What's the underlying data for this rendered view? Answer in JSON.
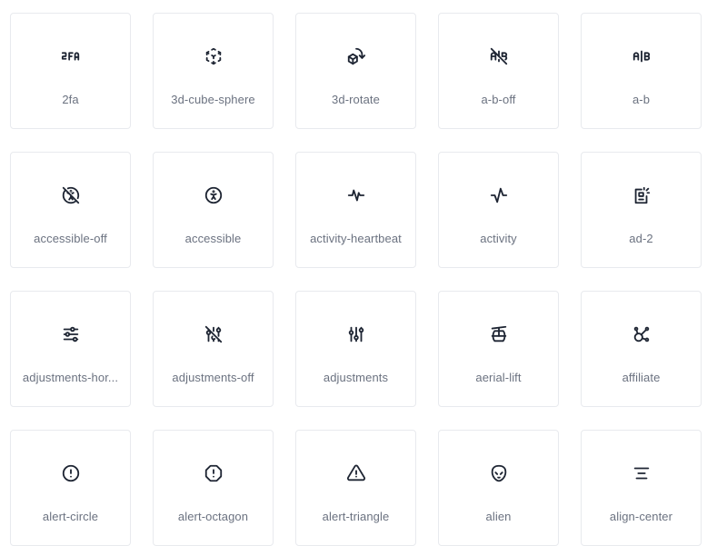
{
  "icons": [
    {
      "name": "2fa",
      "icon": "2fa-icon"
    },
    {
      "name": "3d-cube-sphere",
      "icon": "3d-cube-sphere-icon"
    },
    {
      "name": "3d-rotate",
      "icon": "3d-rotate-icon"
    },
    {
      "name": "a-b-off",
      "icon": "a-b-off-icon"
    },
    {
      "name": "a-b",
      "icon": "a-b-icon"
    },
    {
      "name": "accessible-off",
      "icon": "accessible-off-icon"
    },
    {
      "name": "accessible",
      "icon": "accessible-icon"
    },
    {
      "name": "activity-heartbeat",
      "icon": "activity-heartbeat-icon"
    },
    {
      "name": "activity",
      "icon": "activity-icon"
    },
    {
      "name": "ad-2",
      "icon": "ad-2-icon"
    },
    {
      "name": "adjustments-hor...",
      "icon": "adjustments-horizontal-icon"
    },
    {
      "name": "adjustments-off",
      "icon": "adjustments-off-icon"
    },
    {
      "name": "adjustments",
      "icon": "adjustments-icon"
    },
    {
      "name": "aerial-lift",
      "icon": "aerial-lift-icon"
    },
    {
      "name": "affiliate",
      "icon": "affiliate-icon"
    },
    {
      "name": "alert-circle",
      "icon": "alert-circle-icon"
    },
    {
      "name": "alert-octagon",
      "icon": "alert-octagon-icon"
    },
    {
      "name": "alert-triangle",
      "icon": "alert-triangle-icon"
    },
    {
      "name": "alien",
      "icon": "alien-icon"
    },
    {
      "name": "align-center",
      "icon": "align-center-icon"
    }
  ]
}
